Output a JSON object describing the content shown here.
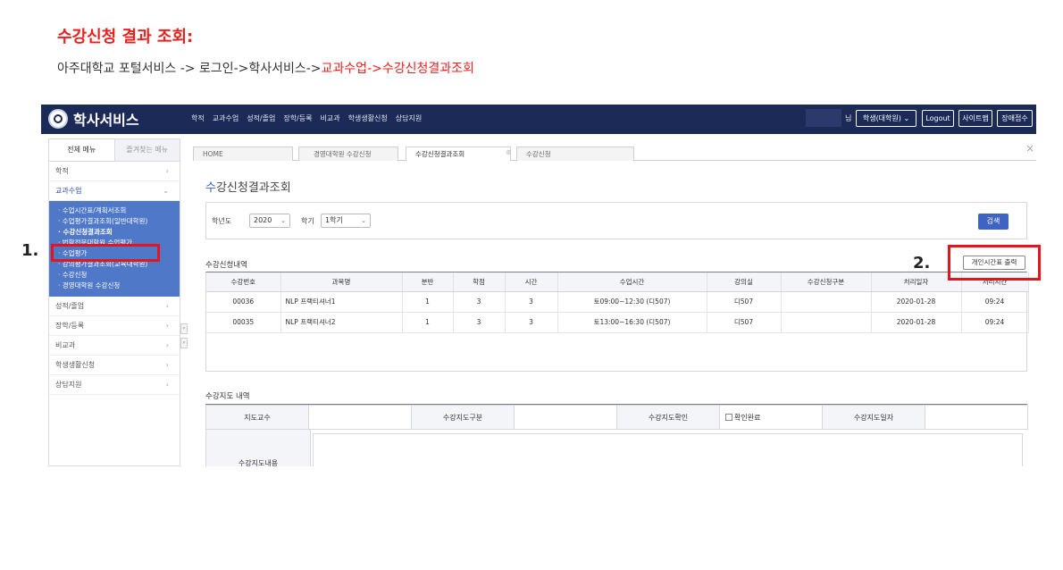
{
  "doc": {
    "title": "수강신청 결과 조회:",
    "path_prefix": "아주대학교 포털서비스 -> 로그인->학사서비스->",
    "path_highlight": "교과수업->수강신청결과조회"
  },
  "topbar": {
    "logo_text": "학사서비스",
    "menu": [
      "학적",
      "교과수업",
      "성적/졸업",
      "장학/등록",
      "비교과",
      "학생생활신청",
      "상담지원"
    ],
    "user_suffix": "님",
    "role_label": "학생(대학원)",
    "logout_label": "Logout",
    "sitemap_label": "사이트맵",
    "disabled_label": "장애접수"
  },
  "sidebar": {
    "tab_all": "전체 메뉴",
    "tab_fav": "즐겨찾는 메뉴",
    "items": [
      "학적",
      "교과수업",
      "성적/졸업",
      "장학/등록",
      "비교과",
      "학생생활신청",
      "상담지원"
    ],
    "sub_items": [
      "· 수업시간표/계획서조회",
      "· 수업평가결과조회(일반대학원)",
      "· 수강신청결과조회",
      "· 법학전문대학원 수업평가",
      "· 수업평가",
      "· 강의평가결과조회(교육대학원)",
      "· 수강신청",
      "· 경영대학원 수강신청"
    ]
  },
  "tabs": [
    "HOME",
    "경영대학원 수강신청",
    "수강신청결과조회",
    "수강신청"
  ],
  "page": {
    "title_first": "수",
    "title_rest": "강신청결과조회",
    "year_label": "학년도",
    "year_value": "2020",
    "term_label": "학기",
    "term_value": "1학기",
    "search_label": "검색"
  },
  "enroll": {
    "section_title": "수강신청내역",
    "print_label": "개인시간표 출력",
    "columns": [
      "수강번호",
      "과목명",
      "분반",
      "학점",
      "시간",
      "수업시간",
      "강의실",
      "수강신청구분",
      "처리일자",
      "처리시간"
    ],
    "rows": [
      [
        "00036",
        "NLP 프랙티셔너1",
        "1",
        "3",
        "3",
        "토09:00~12:30 (디507)",
        "디507",
        "",
        "2020-01-28",
        "09:24"
      ],
      [
        "00035",
        "NLP 프랙티셔너2",
        "1",
        "3",
        "3",
        "토13:00~16:30 (디507)",
        "디507",
        "",
        "2020-01-28",
        "09:24"
      ]
    ]
  },
  "guide": {
    "section_title": "수강지도 내역",
    "professor_label": "지도교수",
    "type_label": "수강지도구분",
    "confirm_label": "수강지도확인",
    "confirm_done": "확인완료",
    "date_label": "수강지도일자",
    "content_label": "수강지도내용"
  },
  "annotations": {
    "step1": "1.",
    "step2": "2."
  },
  "colors": {
    "accent_red": "#e8211f",
    "topbar_navy": "#1b2a57",
    "menu_blue": "#4f78c9",
    "button_blue": "#3e63c4"
  }
}
